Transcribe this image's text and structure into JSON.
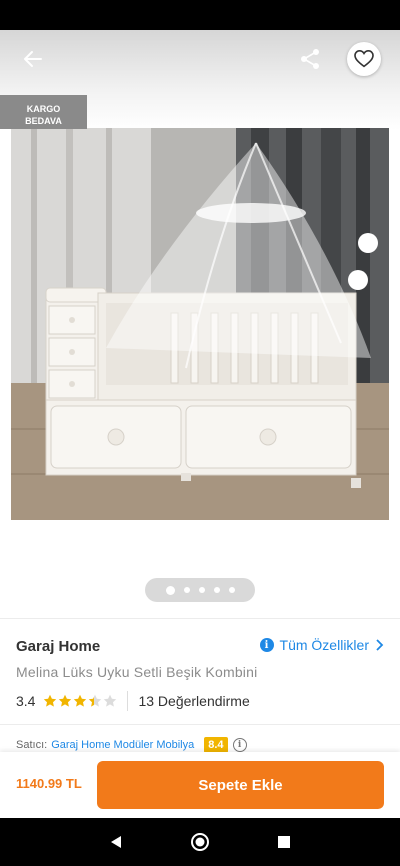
{
  "badge": {
    "line1": "KARGO",
    "line2": "BEDAVA"
  },
  "icons": {
    "back": "arrow-left-icon",
    "share": "share-icon",
    "favorite": "heart-outline-icon",
    "info": "info-icon",
    "chevron": "chevron-right-icon"
  },
  "gallery": {
    "image_count": 5,
    "active_index": 0
  },
  "product": {
    "brand": "Garaj Home",
    "all_features_label": "Tüm Özellikler",
    "name": "Melina Lüks Uyku Setli Beşik Kombini",
    "rating": "3.4",
    "rating_value": 3.4,
    "rating_max": 5,
    "review_count": "13 Değerlendirme"
  },
  "seller": {
    "label": "Satıcı:",
    "name": "Garaj Home Modüler Mobilya",
    "score": "8.4"
  },
  "bottom": {
    "price": "1140.99 TL",
    "cart_label": "Sepete Ekle"
  },
  "colors": {
    "accent": "#f27a1a",
    "link": "#1e88e5",
    "star": "#f1b500",
    "score_badge": "#f1b500"
  }
}
